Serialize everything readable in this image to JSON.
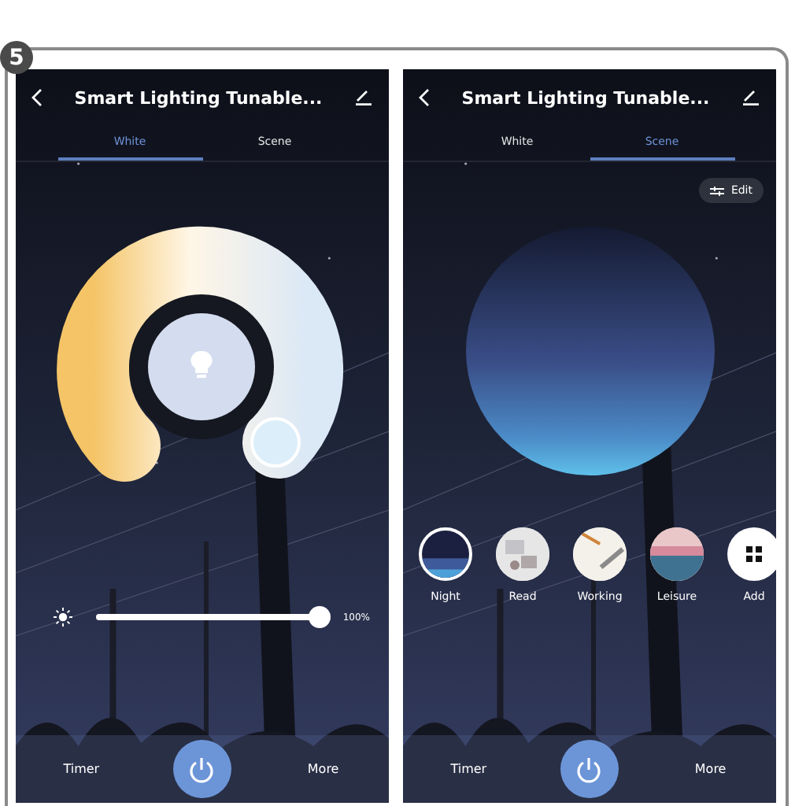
{
  "step_badge": "5",
  "screens": [
    {
      "kind": "white",
      "title": "Smart Lighting Tunable...",
      "tabs": [
        {
          "label": "White",
          "selected": true
        },
        {
          "label": "Scene",
          "selected": false
        }
      ],
      "brightness": {
        "level": 1,
        "reading": "100%"
      },
      "bottom": {
        "timer": "Timer",
        "more": "More"
      }
    },
    {
      "kind": "scene",
      "title": "Smart Lighting Tunable...",
      "tabs": [
        {
          "label": "White",
          "selected": false
        },
        {
          "label": "Scene",
          "selected": true
        }
      ],
      "edit": "Edit",
      "scenes": [
        {
          "label": "Night",
          "selected": true,
          "kind": "night"
        },
        {
          "label": "Read",
          "selected": false,
          "kind": "read"
        },
        {
          "label": "Working",
          "selected": false,
          "kind": "working"
        },
        {
          "label": "Leisure",
          "selected": false,
          "kind": "leisure"
        },
        {
          "label": "Add",
          "selected": false,
          "kind": "add"
        }
      ],
      "bottom": {
        "timer": "Timer",
        "more": "More"
      }
    }
  ]
}
